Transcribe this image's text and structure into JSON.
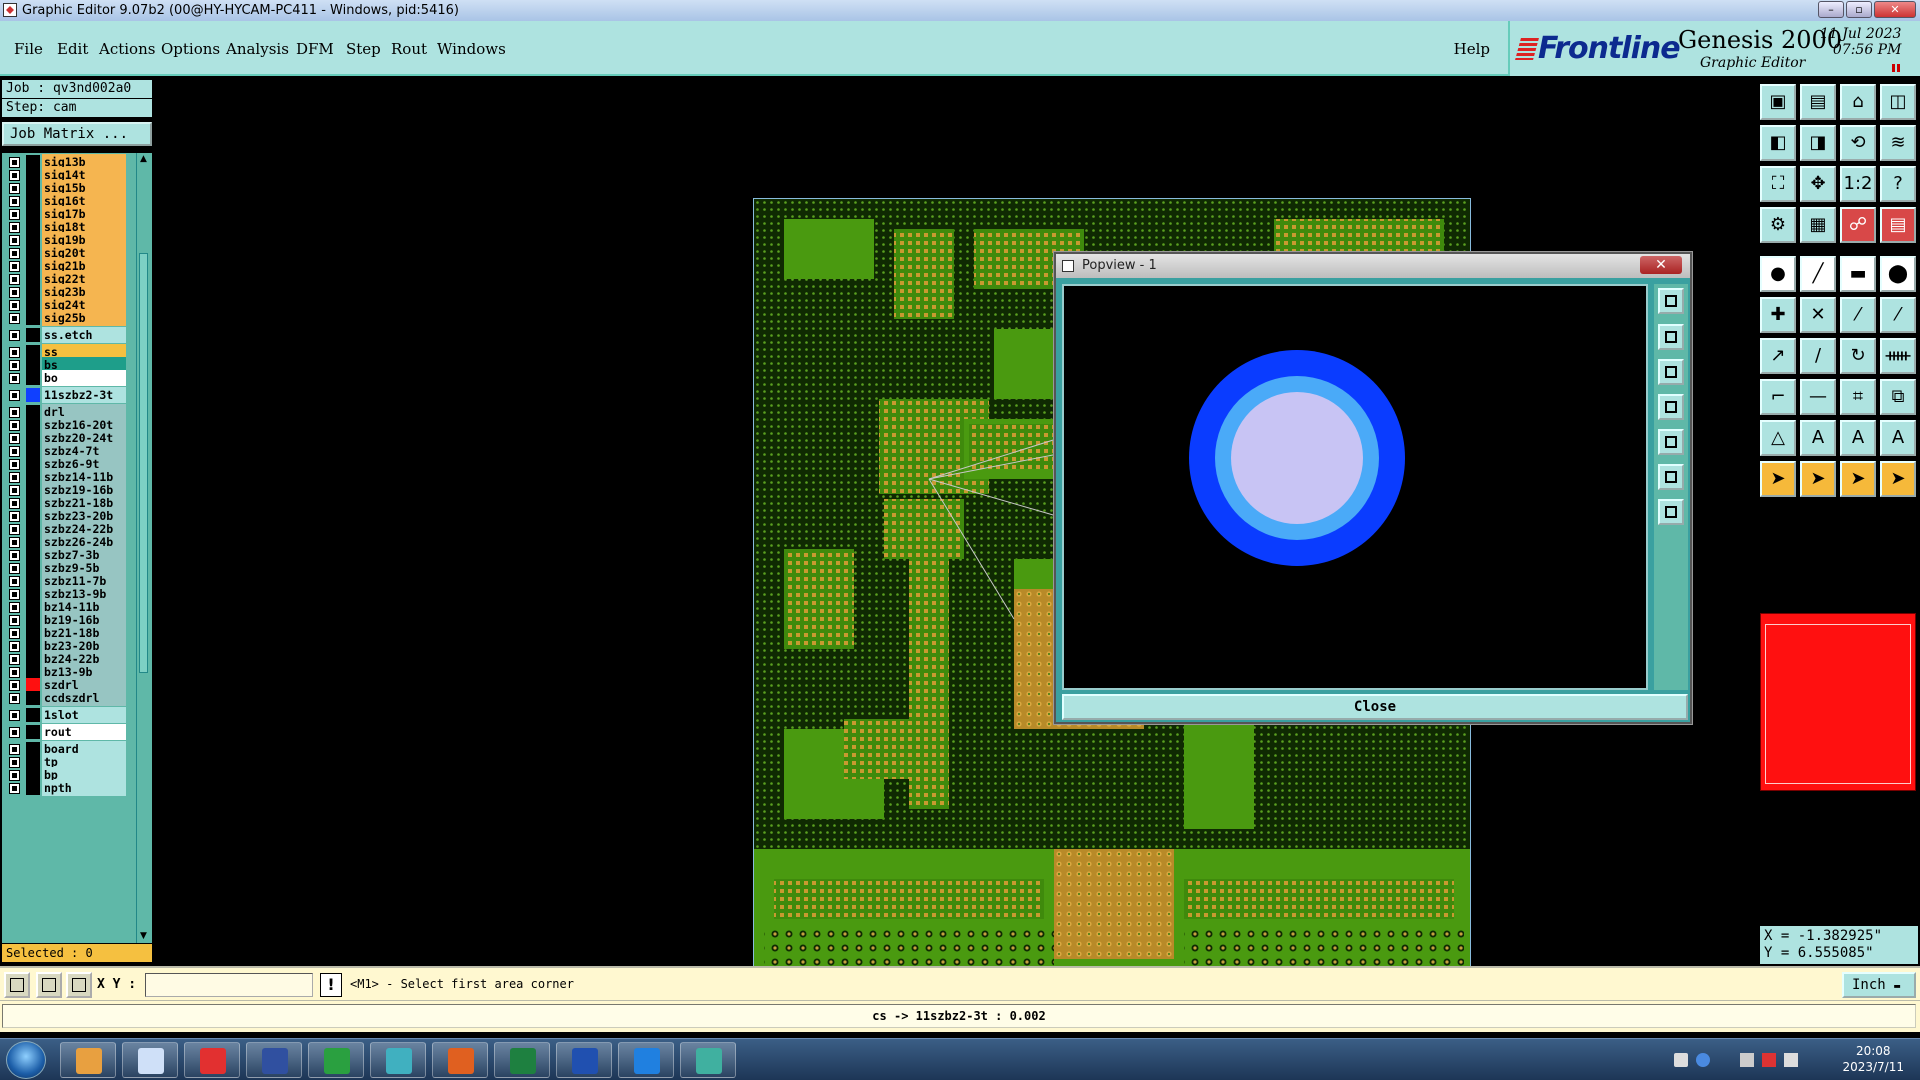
{
  "window": {
    "title": "Graphic Editor 9.07b2 (00@HY-HYCAM-PC411 - Windows, pid:5416)",
    "controls": [
      "minimize",
      "restore",
      "close"
    ]
  },
  "menu": {
    "items": [
      "File",
      "Edit",
      "Actions",
      "Options",
      "Analysis",
      "DFM",
      "Step",
      "Rout",
      "Windows"
    ],
    "help": "Help"
  },
  "brand": {
    "company": "Frontline",
    "product": "Genesis 2000",
    "subtitle": "Graphic Editor",
    "date": "11 Jul 2023",
    "time": "07:56 PM"
  },
  "job": {
    "job_line": "Job : qv3nd002a0",
    "step_line": "Step: cam",
    "matrix_button": "Job Matrix ..."
  },
  "layers": [
    {
      "name": "sig13b",
      "kind": "sig",
      "swatch": "#000000"
    },
    {
      "name": "sig14t",
      "kind": "sig",
      "swatch": "#000000"
    },
    {
      "name": "sig15b",
      "kind": "sig",
      "swatch": "#000000"
    },
    {
      "name": "sig16t",
      "kind": "sig",
      "swatch": "#000000"
    },
    {
      "name": "sig17b",
      "kind": "sig",
      "swatch": "#000000"
    },
    {
      "name": "sig18t",
      "kind": "sig",
      "swatch": "#000000"
    },
    {
      "name": "sig19b",
      "kind": "sig",
      "swatch": "#000000"
    },
    {
      "name": "sig20t",
      "kind": "sig",
      "swatch": "#000000"
    },
    {
      "name": "sig21b",
      "kind": "sig",
      "swatch": "#000000"
    },
    {
      "name": "sig22t",
      "kind": "sig",
      "swatch": "#000000"
    },
    {
      "name": "sig23b",
      "kind": "sig",
      "swatch": "#000000"
    },
    {
      "name": "sig24t",
      "kind": "sig",
      "swatch": "#000000"
    },
    {
      "name": "sig25b",
      "kind": "sig",
      "swatch": "#000000"
    },
    {
      "name": "ss.etch",
      "kind": "misc",
      "swatch": "#000000",
      "gap": true
    },
    {
      "name": "ss",
      "kind": "ss",
      "swatch": "#000000",
      "gap": true
    },
    {
      "name": "bs",
      "kind": "bs",
      "swatch": "#000000"
    },
    {
      "name": "bo",
      "kind": "bo",
      "swatch": "#000000"
    },
    {
      "name": "11szbz2-3t",
      "kind": "misc",
      "swatch": "#1040ff",
      "gap": true
    },
    {
      "name": "drl",
      "kind": "drl",
      "swatch": "#000000",
      "gap": true
    },
    {
      "name": "szbz16-20t",
      "kind": "drl",
      "swatch": "#000000"
    },
    {
      "name": "szbz20-24t",
      "kind": "drl",
      "swatch": "#000000"
    },
    {
      "name": "szbz4-7t",
      "kind": "drl",
      "swatch": "#000000"
    },
    {
      "name": "szbz6-9t",
      "kind": "drl",
      "swatch": "#000000"
    },
    {
      "name": "szbz14-11b",
      "kind": "drl",
      "swatch": "#000000"
    },
    {
      "name": "szbz19-16b",
      "kind": "drl",
      "swatch": "#000000"
    },
    {
      "name": "szbz21-18b",
      "kind": "drl",
      "swatch": "#000000"
    },
    {
      "name": "szbz23-20b",
      "kind": "drl",
      "swatch": "#000000"
    },
    {
      "name": "szbz24-22b",
      "kind": "drl",
      "swatch": "#000000"
    },
    {
      "name": "szbz26-24b",
      "kind": "drl",
      "swatch": "#000000"
    },
    {
      "name": "szbz7-3b",
      "kind": "drl",
      "swatch": "#000000"
    },
    {
      "name": "szbz9-5b",
      "kind": "drl",
      "swatch": "#000000"
    },
    {
      "name": "szbz11-7b",
      "kind": "drl",
      "swatch": "#000000"
    },
    {
      "name": "szbz13-9b",
      "kind": "drl",
      "swatch": "#000000"
    },
    {
      "name": "bz14-11b",
      "kind": "drl",
      "swatch": "#000000"
    },
    {
      "name": "bz19-16b",
      "kind": "drl",
      "swatch": "#000000"
    },
    {
      "name": "bz21-18b",
      "kind": "drl",
      "swatch": "#000000"
    },
    {
      "name": "bz23-20b",
      "kind": "drl",
      "swatch": "#000000"
    },
    {
      "name": "bz24-22b",
      "kind": "drl",
      "swatch": "#000000"
    },
    {
      "name": "bz13-9b",
      "kind": "drl",
      "swatch": "#000000"
    },
    {
      "name": "szdrl",
      "kind": "drl",
      "swatch": "#ff1010"
    },
    {
      "name": "ccdszdrl",
      "kind": "drl",
      "swatch": "#000000"
    },
    {
      "name": "1slot",
      "kind": "misc",
      "swatch": "#000000",
      "gap": true
    },
    {
      "name": "rout",
      "kind": "bo",
      "swatch": "#000000",
      "gap": true
    },
    {
      "name": "board",
      "kind": "misc",
      "swatch": "#000000",
      "gap": true
    },
    {
      "name": "tp",
      "kind": "misc",
      "swatch": "#000000"
    },
    {
      "name": "bp",
      "kind": "misc",
      "swatch": "#000000"
    },
    {
      "name": "npth",
      "kind": "misc",
      "swatch": "#000000"
    }
  ],
  "selected": "Selected : 0",
  "popview": {
    "title": "Popview - 1",
    "close_button": "Close"
  },
  "coordinates": {
    "x": "X = -1.382925\"",
    "y": "Y = 6.555085\""
  },
  "command": {
    "xy_label": "X Y :",
    "xy_value": "",
    "bang": "!",
    "prompt": "<M1> - Select first area corner",
    "units": "Inch"
  },
  "status": "cs -> 11szbz2-3t : 0.002",
  "taskbar": {
    "time": "20:08",
    "date": "2023/7/11"
  },
  "colors": {
    "panel": "#aee3e0",
    "signal_layer": "#f5b550",
    "board_copper": "#4a9a10",
    "pad": "#c89a30",
    "popview_outer_ring": "#0a3cff",
    "popview_middle_ring": "#4aaaf8",
    "popview_inner_pad": "#c8c4f4"
  }
}
